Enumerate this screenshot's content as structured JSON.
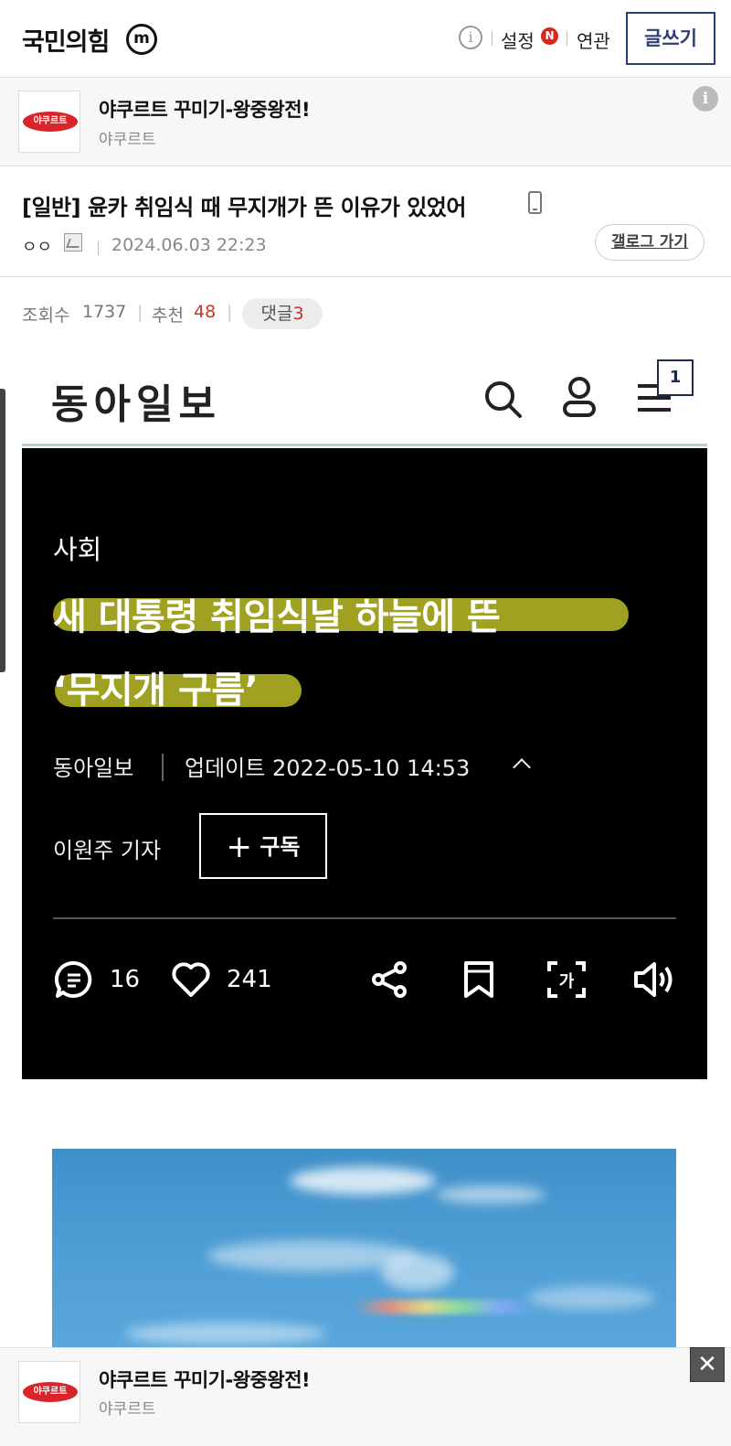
{
  "topbar": {
    "gallery_name": "국민의힘",
    "mini_badge": "m",
    "info_glyph": "i",
    "settings_label": "설정",
    "settings_badge": "N",
    "related_label": "연관",
    "write_label": "글쓰기"
  },
  "ad": {
    "title": "야쿠르트 꾸미기-왕중왕전!",
    "sponsor": "야쿠르트",
    "logo_text": "야쿠르트",
    "info_glyph": "i",
    "close_glyph": "✕"
  },
  "post": {
    "title": "[일반] 윤카 취임식 때 무지개가 뜬 이유가 있었어",
    "author": "ㅇㅇ",
    "datetime": "2024.06.03 22:23",
    "gallery_go_label": "갤로그 가기",
    "views_label": "조회수",
    "views": "1737",
    "recommend_label": "추천",
    "recommend": "48",
    "comments_label": "댓글",
    "comments": "3"
  },
  "embed": {
    "news_logo": "동아일보",
    "menu_badge": "1",
    "category": "사회",
    "headline_line1": "새 대통령 취임식날 하늘에 뜬",
    "headline_line2": "‘무지개 구름’",
    "source": "동아일보",
    "updated": "업데이트 2022-05-10 14:53",
    "reporter": "이원주 기자",
    "subscribe_label": "구독",
    "comment_count": "16",
    "like_count": "241"
  },
  "colors": {
    "write_button": "#2f3f76",
    "accent_red": "#c0392b",
    "highlight": "#c4c428",
    "article_bg": "#000000"
  },
  "icons": [
    "m-icon",
    "info-icon",
    "mobile-icon",
    "search-icon",
    "user-icon",
    "menu-icon",
    "comment-icon",
    "heart-icon",
    "share-icon",
    "bookmark-icon",
    "translate-icon",
    "speaker-icon",
    "close-icon"
  ]
}
